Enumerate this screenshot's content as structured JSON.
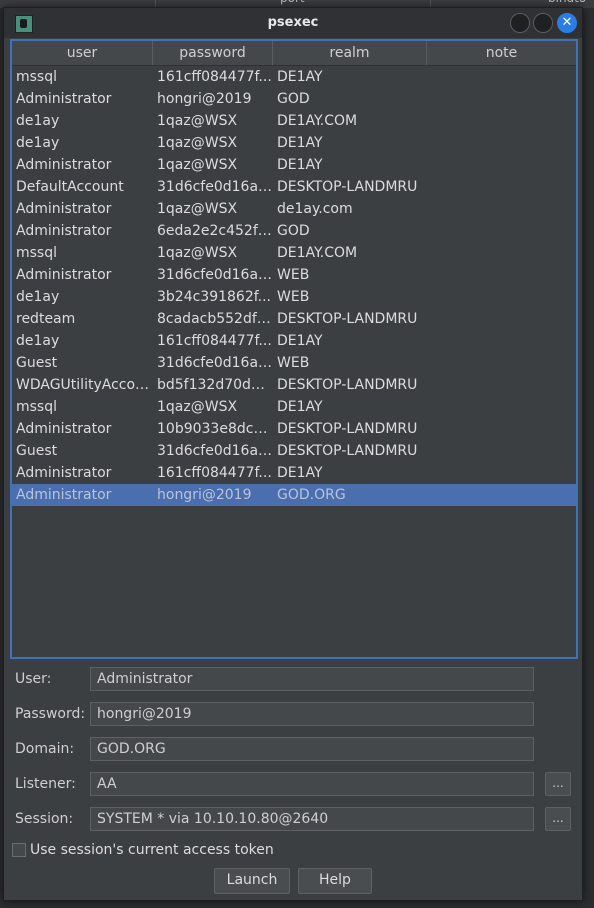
{
  "background": {
    "col1": "port",
    "col2": "bindto"
  },
  "window": {
    "title": "psexec",
    "close_glyph": "✕"
  },
  "table": {
    "columns": [
      "user",
      "password",
      "realm",
      "note"
    ],
    "rows": [
      {
        "user": "mssql",
        "password": "161cff084477f...",
        "realm": "DE1AY",
        "note": ""
      },
      {
        "user": "Administrator",
        "password": "hongri@2019",
        "realm": "GOD",
        "note": ""
      },
      {
        "user": "de1ay",
        "password": "1qaz@WSX",
        "realm": "DE1AY.COM",
        "note": ""
      },
      {
        "user": "de1ay",
        "password": "1qaz@WSX",
        "realm": "DE1AY",
        "note": ""
      },
      {
        "user": "Administrator",
        "password": "1qaz@WSX",
        "realm": "DE1AY",
        "note": ""
      },
      {
        "user": "DefaultAccount",
        "password": "31d6cfe0d16ae...",
        "realm": "DESKTOP-LANDMRU",
        "note": ""
      },
      {
        "user": "Administrator",
        "password": "1qaz@WSX",
        "realm": "de1ay.com",
        "note": ""
      },
      {
        "user": "Administrator",
        "password": "6eda2e2c452f2...",
        "realm": "GOD",
        "note": ""
      },
      {
        "user": "mssql",
        "password": "1qaz@WSX",
        "realm": "DE1AY.COM",
        "note": ""
      },
      {
        "user": "Administrator",
        "password": "31d6cfe0d16ae...",
        "realm": "WEB",
        "note": ""
      },
      {
        "user": "de1ay",
        "password": "3b24c391862f...",
        "realm": "WEB",
        "note": ""
      },
      {
        "user": "redteam",
        "password": "8cadacb552df1...",
        "realm": "DESKTOP-LANDMRU",
        "note": ""
      },
      {
        "user": "de1ay",
        "password": "161cff084477f...",
        "realm": "DE1AY",
        "note": ""
      },
      {
        "user": "Guest",
        "password": "31d6cfe0d16ae...",
        "realm": "WEB",
        "note": ""
      },
      {
        "user": "WDAGUtilityAccount",
        "password": "bd5f132d70d00...",
        "realm": "DESKTOP-LANDMRU",
        "note": ""
      },
      {
        "user": "mssql",
        "password": "1qaz@WSX",
        "realm": "DE1AY",
        "note": ""
      },
      {
        "user": "Administrator",
        "password": "10b9033e8dcef...",
        "realm": "DESKTOP-LANDMRU",
        "note": ""
      },
      {
        "user": "Guest",
        "password": "31d6cfe0d16ae...",
        "realm": "DESKTOP-LANDMRU",
        "note": ""
      },
      {
        "user": "Administrator",
        "password": "161cff084477f...",
        "realm": "DE1AY",
        "note": ""
      },
      {
        "user": "Administrator",
        "password": "hongri@2019",
        "realm": "GOD.ORG",
        "note": ""
      }
    ],
    "selected_row": 19
  },
  "form": {
    "user_label": "User:",
    "user_value": "Administrator",
    "password_label": "Password:",
    "password_value": "hongri@2019",
    "domain_label": "Domain:",
    "domain_value": "GOD.ORG",
    "listener_label": "Listener:",
    "listener_value": "AA",
    "session_label": "Session:",
    "session_value": "SYSTEM * via  10.10.10.80@2640",
    "browse_label": "...",
    "token_checkbox_label": "Use session's current access token",
    "token_checked": false
  },
  "buttons": {
    "launch": "Launch",
    "help": "Help"
  },
  "colors": {
    "selection": "#4b6eaf",
    "table_border": "#3f73b8",
    "close_button": "#2a7de1"
  }
}
